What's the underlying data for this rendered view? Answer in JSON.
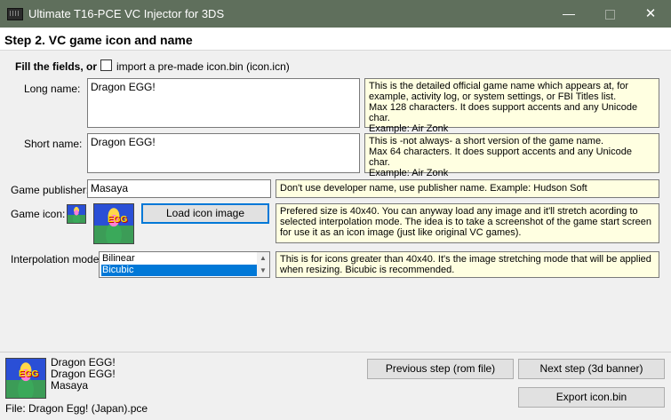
{
  "window": {
    "title": "Ultimate T16-PCE VC Injector for 3DS",
    "controls": {
      "minimize": "—",
      "close": "✕"
    }
  },
  "step": {
    "title": "Step 2. VC game icon and name"
  },
  "fill_fields": {
    "label": "Fill the fields, or",
    "import_label": "import a pre-made icon.bin (icon.icn)",
    "import_checked": false
  },
  "fields": {
    "long_name": {
      "label": "Long name:",
      "value": "Dragon EGG!",
      "help": "This is the detailed official game name which appears at, for example, activity log, or system settings, or FBI Titles list.\nMax 128 characters. It does support accents and any Unicode char.\nExample: Air Zonk"
    },
    "short_name": {
      "label": "Short name:",
      "value": "Dragon EGG!",
      "help": "This is -not always- a short version of the game name.\nMax 64 characters. It does support accents and any Unicode char.\nExample: Air Zonk"
    },
    "publisher": {
      "label": "Game publisher:",
      "value": "Masaya",
      "help": "Don't use developer name, use publisher name. Example: Hudson Soft"
    },
    "game_icon": {
      "label": "Game icon:",
      "load_button": "Load icon image",
      "help": "Prefered size is 40x40. You can anyway load any image and it'll stretch acording to selected interpolation mode. The idea is to take a screenshot of the game start screen for use it as an icon image (just like original VC games)."
    },
    "interpolation": {
      "label": "Interpolation mode:",
      "options": [
        "Bilinear",
        "Bicubic"
      ],
      "selected": "Bicubic",
      "help": "This is for icons greater than 40x40. It's the image stretching mode that will be applied when resizing. Bicubic is recommended."
    }
  },
  "preview": {
    "long_name": "Dragon EGG!",
    "short_name": "Dragon EGG!",
    "publisher": "Masaya",
    "file": "File: Dragon Egg! (Japan).pce"
  },
  "buttons": {
    "previous": "Previous step (rom file)",
    "next": "Next step (3d banner)",
    "export": "Export icon.bin"
  }
}
